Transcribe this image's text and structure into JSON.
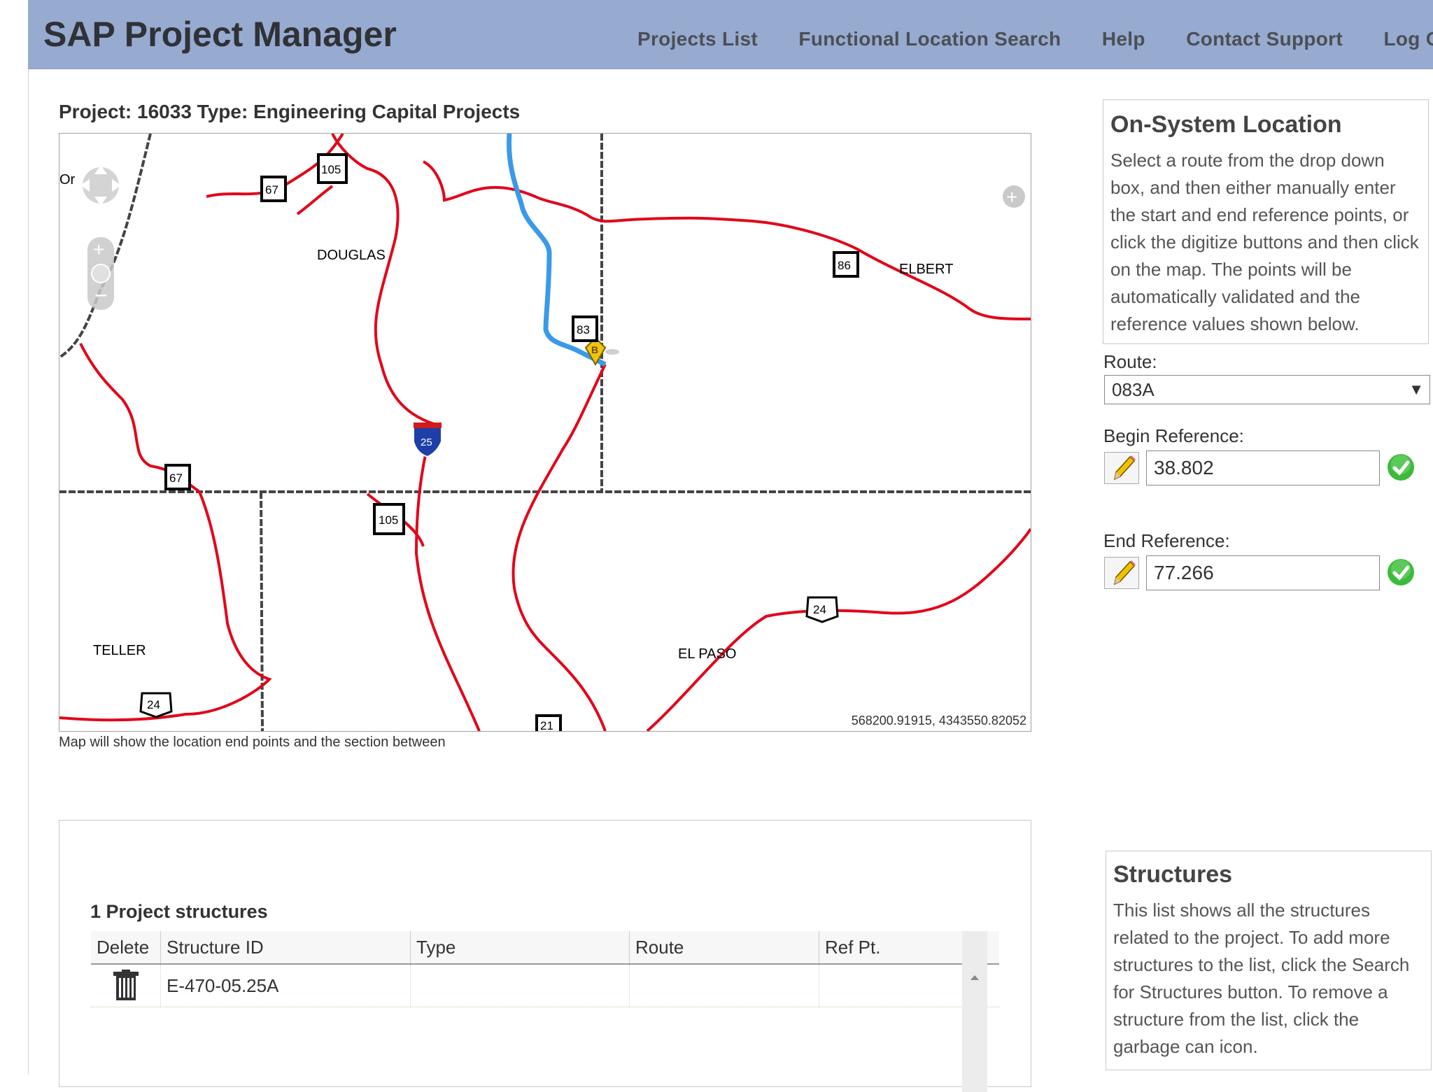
{
  "app": {
    "title": "SAP Project Manager"
  },
  "nav": {
    "items": [
      {
        "label": "Projects List"
      },
      {
        "label": "Functional Location Search"
      },
      {
        "label": "Help"
      },
      {
        "label": "Contact Support"
      },
      {
        "label": "Log Ou"
      }
    ]
  },
  "project": {
    "title": "Project: 16033 Type: Engineering Capital Projects"
  },
  "map": {
    "caption": "Map will show the location end points and the section between",
    "coordinates": "568200.91915, 4343550.82052",
    "county_labels": [
      "DOUGLAS",
      "ELBERT",
      "TELLER",
      "EL PASO",
      "Or"
    ],
    "route_shields": [
      "67",
      "105",
      "86",
      "25",
      "67",
      "105",
      "24",
      "24",
      "21",
      "83"
    ],
    "marker_label": "B",
    "colors": {
      "road": "#e2061a",
      "selected_route": "#3a9ae8",
      "county_border": "#444444"
    }
  },
  "structures_grid": {
    "count_label": "1 Project structures",
    "columns": [
      "Delete",
      "Structure ID",
      "Type",
      "Route",
      "Ref Pt."
    ],
    "rows": [
      {
        "structure_id": "E-470-05.25A",
        "type": "",
        "route": "",
        "ref_pt": ""
      }
    ]
  },
  "on_system": {
    "title": "On-System Location",
    "description": "Select a route from the drop down box, and then either manually enter the start and end reference points, or click the digitize buttons and then click on the map. The points will be automatically validated and the reference values shown below.",
    "route_label": "Route:",
    "route_value": "083A",
    "begin_label": "Begin Reference:",
    "begin_value": "38.802",
    "end_label": "End Reference:",
    "end_value": "77.266"
  },
  "structures_panel": {
    "title": "Structures",
    "description": "This list shows all the structures related to the project. To add more structures to the list, click the Search for Structures button. To remove a structure from the list, click the garbage can icon."
  }
}
